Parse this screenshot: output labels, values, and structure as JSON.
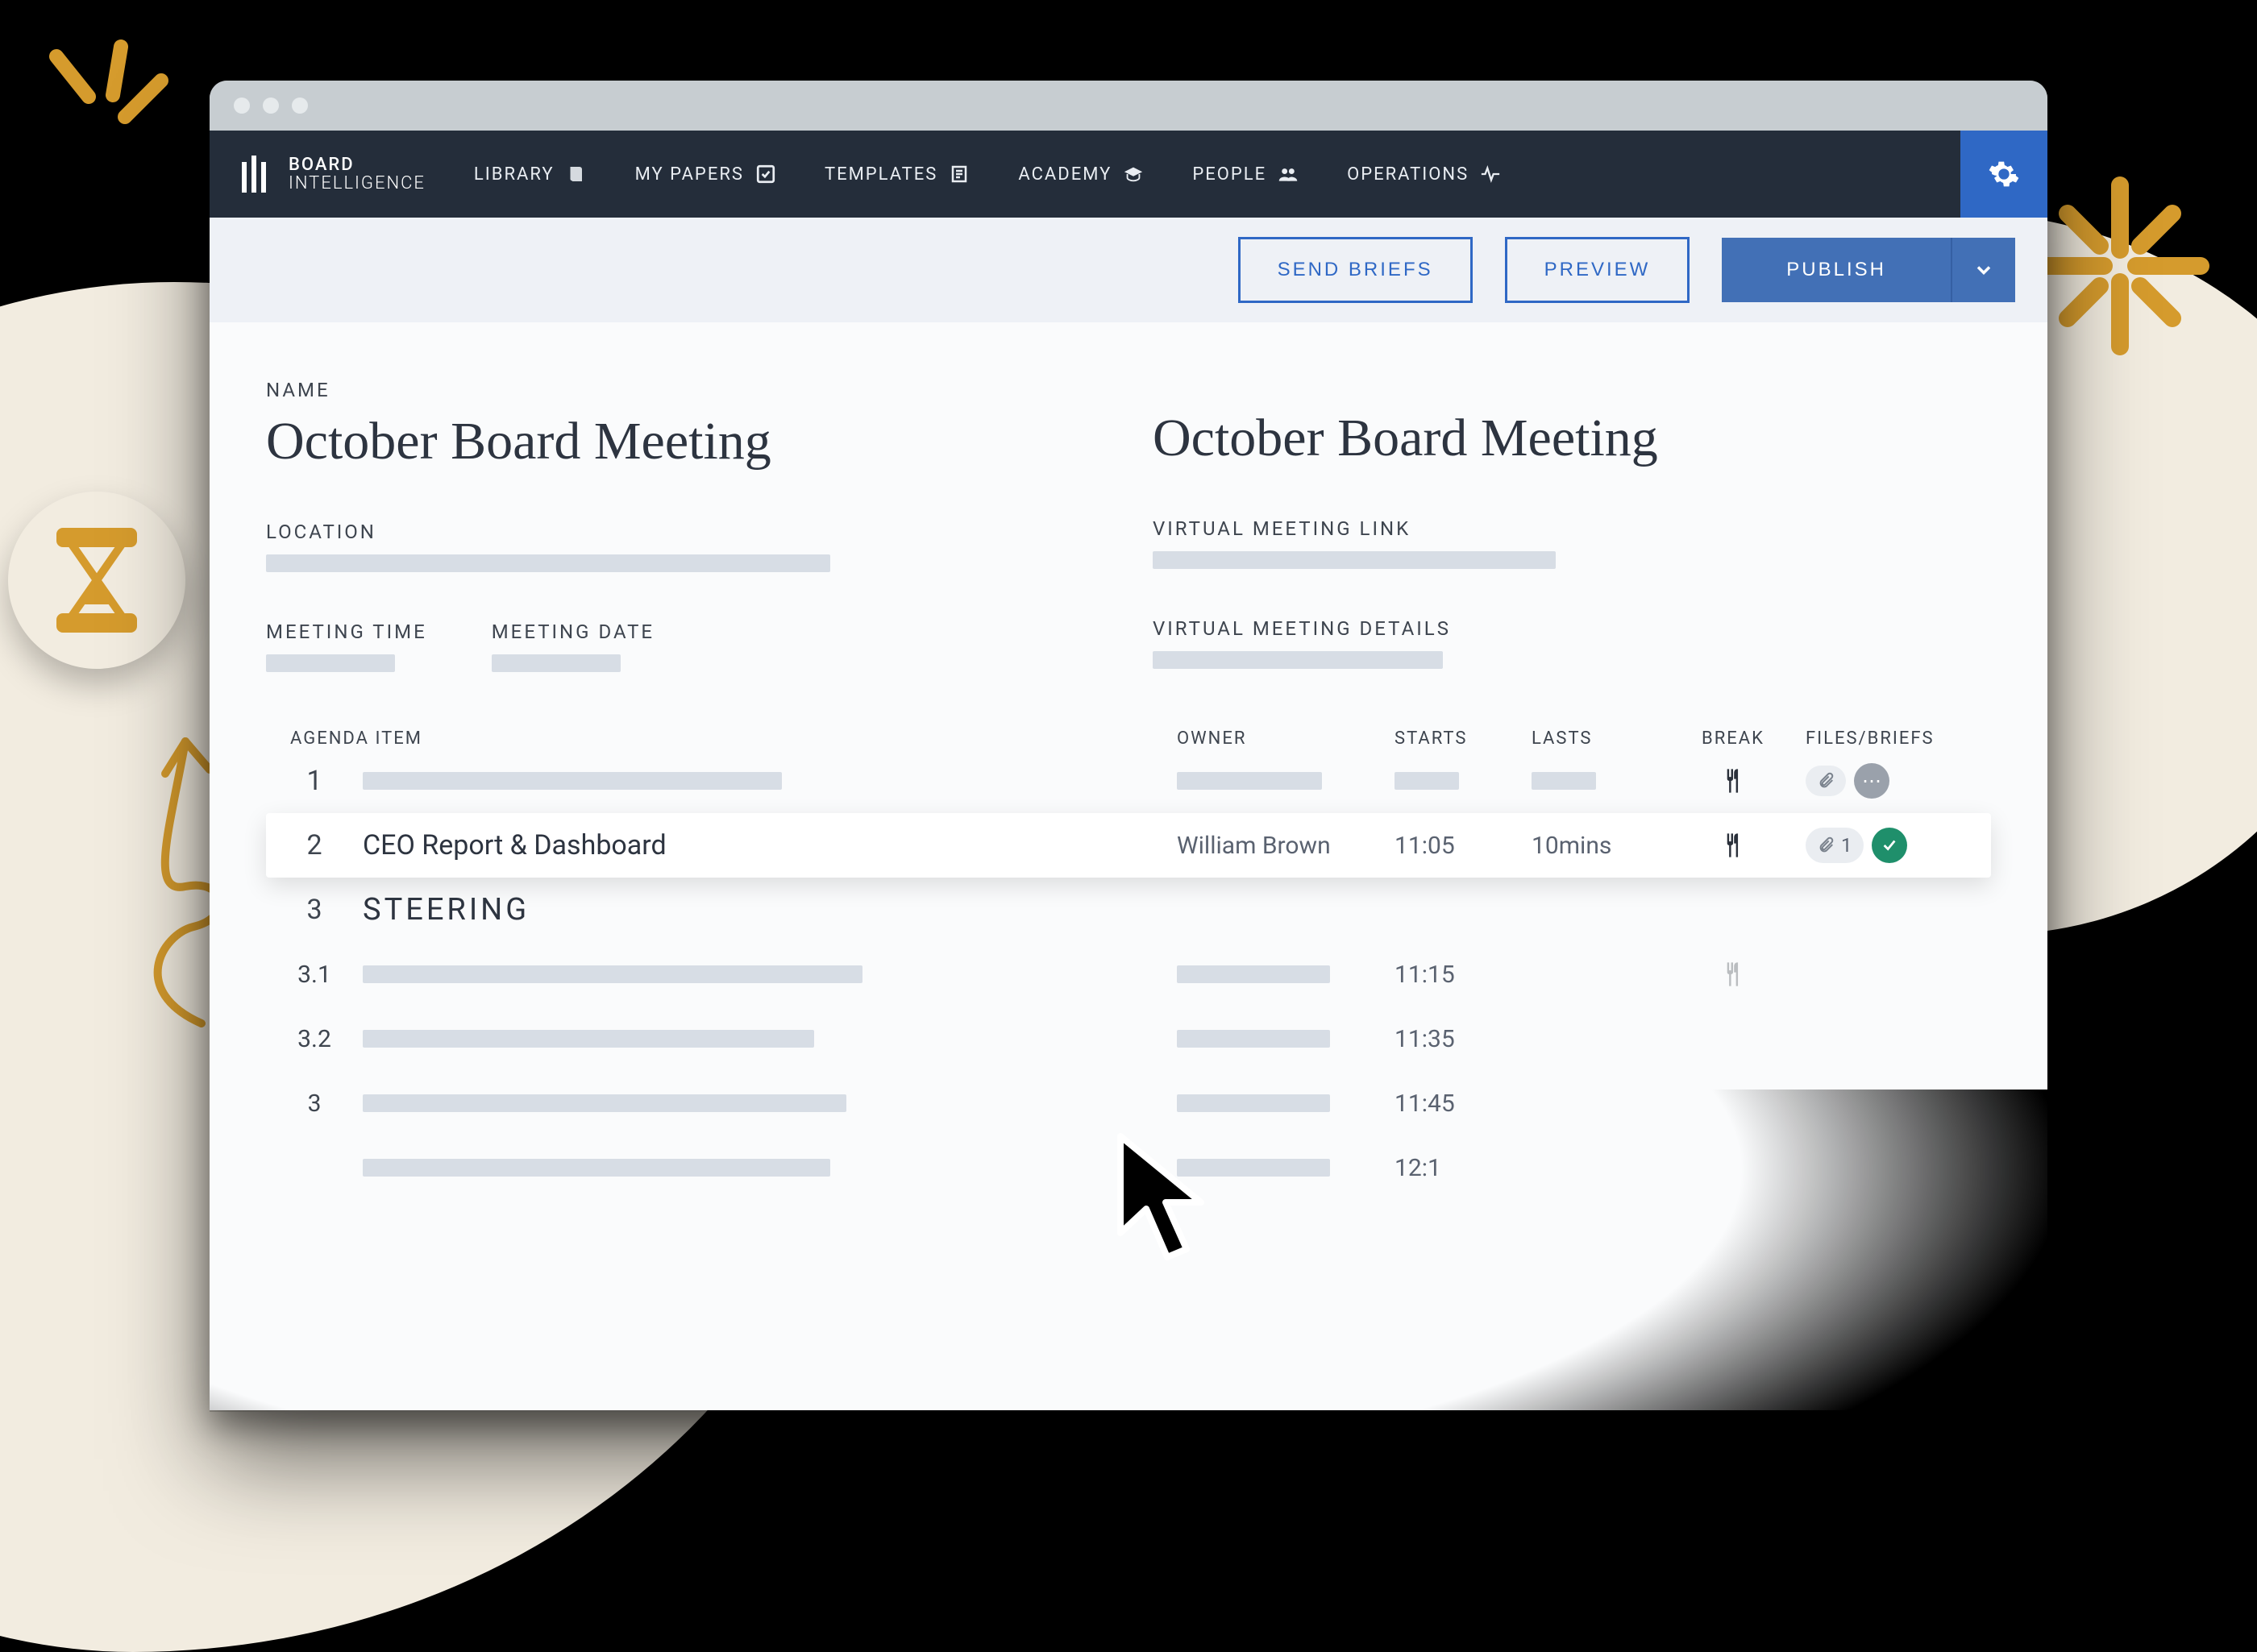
{
  "brand": {
    "line1": "BOARD",
    "line2": "INTELLIGENCE"
  },
  "nav": {
    "library": "LIBRARY",
    "mypapers": "MY PAPERS",
    "templates": "TEMPLATES",
    "academy": "ACADEMY",
    "people": "PEOPLE",
    "operations": "OPERATIONS"
  },
  "actions": {
    "send_briefs": "SEND BRIEFS",
    "preview": "PREVIEW",
    "publish": "PUBLISH"
  },
  "labels": {
    "name": "NAME",
    "location": "LOCATION",
    "meeting_time": "MEETING TIME",
    "meeting_date": "MEETING DATE",
    "virtual_link": "VIRTUAL MEETING LINK",
    "virtual_details": "VIRTUAL MEETING DETAILS",
    "agenda_item": "AGENDA ITEM",
    "owner": "OWNER",
    "starts": "STARTS",
    "lasts": "LASTS",
    "break": "BREAK",
    "files": "FILES/BRIEFS"
  },
  "meeting": {
    "title_left": "October Board Meeting",
    "title_right": "October Board Meeting"
  },
  "agenda": [
    {
      "idx": "1",
      "title": "",
      "owner": "",
      "starts": "",
      "lasts": "",
      "break": true,
      "files_count": "",
      "files_status": "gray"
    },
    {
      "idx": "2",
      "title": "CEO Report & Dashboard",
      "owner": "William Brown",
      "starts": "11:05",
      "lasts": "10mins",
      "break": true,
      "files_count": "1",
      "files_status": "green"
    },
    {
      "idx": "3",
      "title": "STEERING",
      "section": true
    },
    {
      "idx": "3.1",
      "title": "",
      "owner": "",
      "starts": "11:15",
      "lasts": "",
      "break": true,
      "files_count": "",
      "files_status": ""
    },
    {
      "idx": "3.2",
      "title": "",
      "owner": "",
      "starts": "11:35",
      "lasts": "",
      "break": false
    },
    {
      "idx": "3",
      "title": "",
      "owner": "",
      "starts": "11:45",
      "lasts": "",
      "break": false
    },
    {
      "idx": "",
      "title": "",
      "owner": "",
      "starts": "12:1",
      "lasts": "",
      "break": false
    }
  ],
  "colors": {
    "navy": "#242d3a",
    "blue": "#2f68c5",
    "blue_btn": "#4270b6",
    "gold": "#d59b2d",
    "cream": "#f2ece0",
    "green": "#1f8f6b"
  }
}
